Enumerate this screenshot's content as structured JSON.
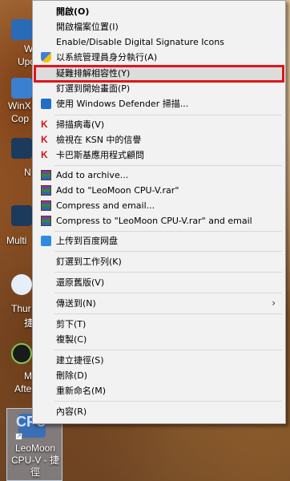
{
  "desktop": {
    "icons": [
      {
        "label": "W",
        "label2": "Upo"
      },
      {
        "label": "WinX",
        "label2": "Cop"
      },
      {
        "label": "N"
      },
      {
        "label": "Multi"
      },
      {
        "label": "Thur",
        "label2": "捷"
      },
      {
        "label": "M",
        "label2": "Afte"
      }
    ],
    "selected": {
      "glyph_text": "CPU",
      "label": "LeoMoon CPU-V - 捷徑"
    }
  },
  "menu": {
    "items": [
      {
        "label": "開啟(O)",
        "icon": ""
      },
      {
        "label": "開啟檔案位置(I)",
        "icon": ""
      },
      {
        "label": "Enable/Disable Digital Signature Icons",
        "icon": ""
      },
      {
        "label": "以系統管理員身分執行(A)",
        "icon": "uac-shield-icon"
      },
      {
        "label": "疑難排解相容性(Y)",
        "icon": ""
      },
      {
        "label": "釘選到開始畫面(P)",
        "icon": ""
      },
      {
        "label": "使用 Windows Defender 掃描...",
        "icon": "windows-defender-icon"
      },
      {
        "label": "掃描病毒(V)",
        "icon": "kaspersky-icon"
      },
      {
        "label": "檢視在 KSN 中的信譽",
        "icon": "kaspersky-icon"
      },
      {
        "label": "卡巴斯基應用程式顧問",
        "icon": "kaspersky-icon"
      },
      {
        "label": "Add to archive...",
        "icon": "winrar-icon"
      },
      {
        "label": "Add to \"LeoMoon CPU-V.rar\"",
        "icon": "winrar-icon"
      },
      {
        "label": "Compress and email...",
        "icon": "winrar-icon"
      },
      {
        "label": "Compress to \"LeoMoon CPU-V.rar\" and email",
        "icon": "winrar-icon"
      },
      {
        "label": "上传到百度网盘",
        "icon": "baidu-netdisk-icon"
      },
      {
        "label": "釘選到工作列(K)",
        "icon": ""
      },
      {
        "label": "還原舊版(V)",
        "icon": ""
      },
      {
        "label": "傳送到(N)",
        "icon": "",
        "submenu": "›"
      },
      {
        "label": "剪下(T)",
        "icon": ""
      },
      {
        "label": "複製(C)",
        "icon": ""
      },
      {
        "label": "建立捷徑(S)",
        "icon": ""
      },
      {
        "label": "刪除(D)",
        "icon": ""
      },
      {
        "label": "重新命名(M)",
        "icon": ""
      },
      {
        "label": "內容(R)",
        "icon": ""
      }
    ],
    "highlighted_item": "疑難排解相容性(Y)",
    "accent_color": "#e0141a"
  }
}
